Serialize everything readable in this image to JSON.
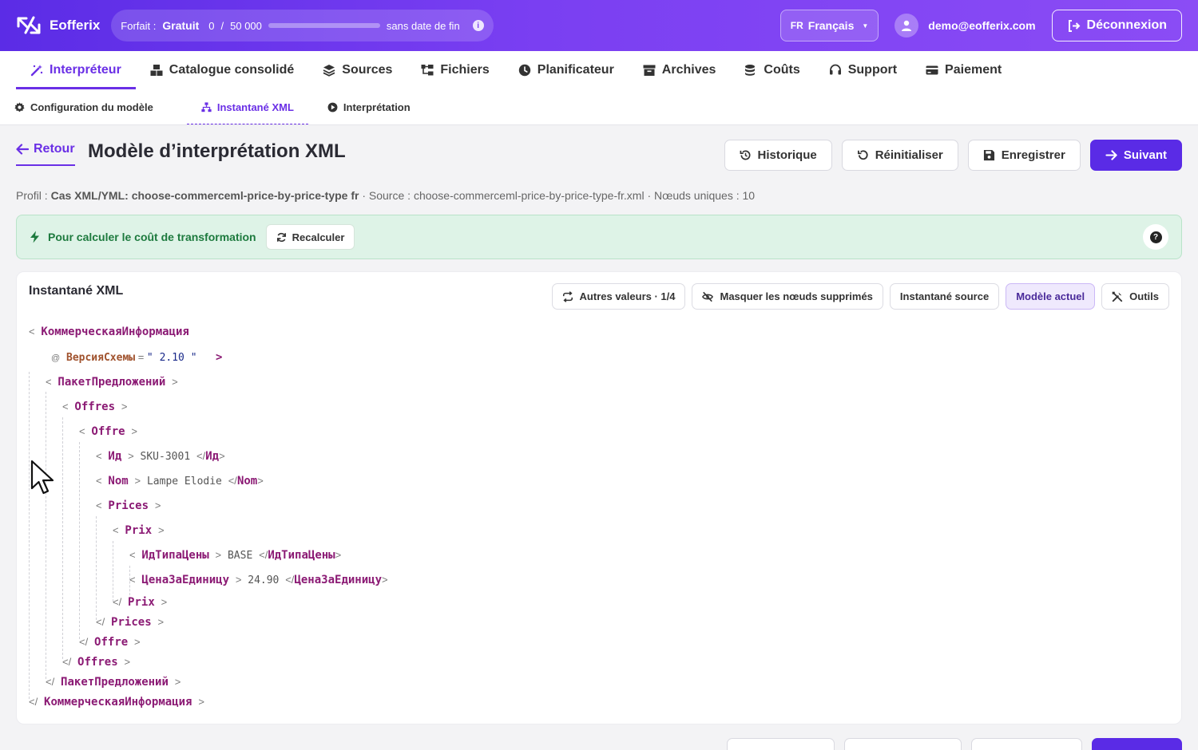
{
  "app": {
    "brand": "Eofferix",
    "plan_label": "Forfait :",
    "plan_name": "Gratuit",
    "usage_used": "0",
    "usage_sep": "/",
    "usage_total": "50 000",
    "usage_progress": 0,
    "plan_expiry": "sans date de fin",
    "language_code": "FR",
    "language_name": "Français",
    "user_email": "demo@eofferix.com",
    "logout_label": "Déconnexion"
  },
  "main_nav": [
    {
      "label": "Interpréteur",
      "icon": "magic-wand-icon",
      "active": true
    },
    {
      "label": "Catalogue consolidé",
      "icon": "boxes-icon"
    },
    {
      "label": "Sources",
      "icon": "layers-icon"
    },
    {
      "label": "Fichiers",
      "icon": "folder-tree-icon"
    },
    {
      "label": "Planificateur",
      "icon": "clock-icon"
    },
    {
      "label": "Archives",
      "icon": "archive-icon"
    },
    {
      "label": "Coûts",
      "icon": "coins-icon"
    },
    {
      "label": "Support",
      "icon": "headset-icon"
    },
    {
      "label": "Paiement",
      "icon": "credit-card-icon"
    }
  ],
  "sub_nav": [
    {
      "label": "Configuration du modèle",
      "icon": "gear-icon"
    },
    {
      "label": "Instantané XML",
      "icon": "sitemap-icon",
      "active": true
    },
    {
      "label": "Interprétation",
      "icon": "play-circle-icon"
    }
  ],
  "header": {
    "back_label": "Retour",
    "title": "Modèle d’interprétation XML",
    "actions": {
      "history": "Historique",
      "reset": "Réinitialiser",
      "save": "Enregistrer",
      "next": "Suivant"
    }
  },
  "profile_line": {
    "profile_label": "Profil :",
    "profile_value": "Cas XML/YML: choose-commerceml-price-by-price-type fr",
    "source_label": "· Source :",
    "source_value": "choose-commerceml-price-by-price-type-fr.xml",
    "nodes_label": "· Nœuds uniques :",
    "nodes_value": "10"
  },
  "banner": {
    "text": "Pour calculer le coût de transformation",
    "recalc_label": "Recalculer",
    "color": "#def3e7"
  },
  "card": {
    "title": "Instantané XML",
    "tools": {
      "other_values": "Autres valeurs · 1/4",
      "hide_deleted": "Masquer les nœuds supprimés",
      "source_snapshot": "Instantané source",
      "current_model": "Modèle actuel",
      "tools": "Outils"
    }
  },
  "xml": {
    "root": "КоммерческаяИнформация",
    "attr_name": "ВерсияСхемы",
    "attr_value": "2.10",
    "package": "ПакетПредложений",
    "offers": "Offres",
    "offer": "Offre",
    "id_tag": "Ид",
    "id_value": "SKU-3001",
    "name_tag": "Nom",
    "name_value": "Lampe Elodie",
    "prices": "Prices",
    "price": "Prix",
    "price_type_tag": "ИдТипаЦены",
    "price_type_value": "BASE",
    "unit_price_tag": "ЦенаЗаЕдиницу",
    "unit_price_value": "24.90"
  },
  "colors": {
    "accent": "#6a2fe6",
    "tag": "#8b1a74",
    "success": "#1d7a3e"
  }
}
